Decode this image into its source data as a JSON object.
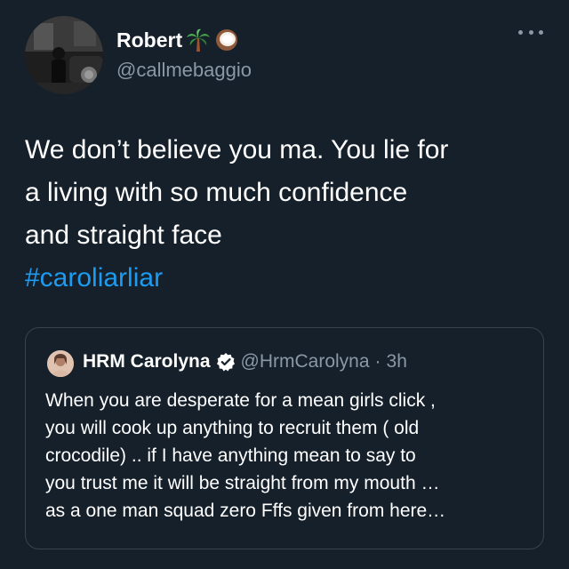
{
  "tweet": {
    "author": {
      "name": "Robert",
      "emojis": [
        "palm-tree-emoji",
        "coconut-emoji"
      ],
      "handle": "@callmebaggio"
    },
    "text_lines": [
      "We don’t believe you ma. You lie for",
      "a living with so much confidence",
      "and straight face"
    ],
    "hashtag": "#caroliarliar"
  },
  "quoted_tweet": {
    "name": "HRM Carolyna",
    "verified": true,
    "handle": "@HrmCarolyna",
    "separator": "·",
    "time": "3h",
    "text_lines": [
      "When you are desperate for a mean girls click  ,",
      "you will cook up anything to recruit them ( old",
      "crocodile) .. if I have anything mean to say to",
      "you trust me it will be straight from my mouth …",
      "as a one man squad zero Fffs given from here…"
    ]
  },
  "colors": {
    "background": "#15202b",
    "text": "#ffffff",
    "secondary": "#8b98a5",
    "accent": "#1d9bf0",
    "border": "#38444d"
  }
}
